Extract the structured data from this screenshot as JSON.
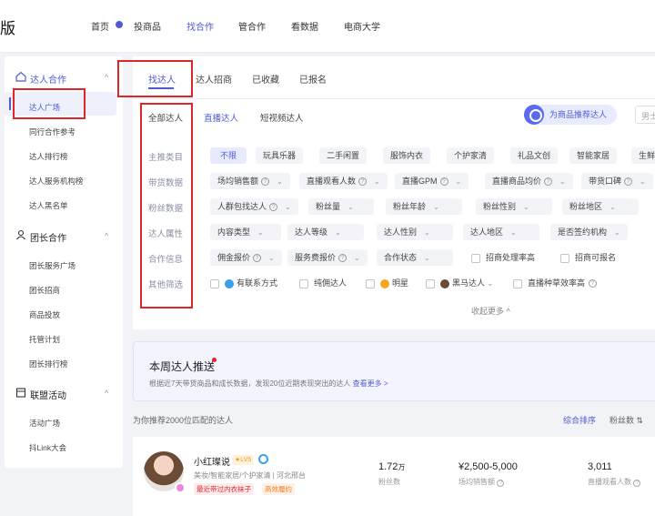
{
  "brand": "版",
  "topnav": {
    "items": [
      "首页",
      "投商品",
      "找合作",
      "管合作",
      "看数据",
      "电商大学"
    ],
    "active": "找合作"
  },
  "sidebar": {
    "sections": [
      {
        "title": "达人合作",
        "items": [
          "达人广场",
          "同行合作参考",
          "达人排行榜",
          "达人服务机构榜",
          "达人黑名单"
        ]
      },
      {
        "title": "团长合作",
        "items": [
          "团长服务广场",
          "团长招商",
          "商品投放",
          "托管计划",
          "团长排行榜"
        ]
      },
      {
        "title": "联盟活动",
        "items": [
          "活动广场",
          "抖Link大会"
        ]
      }
    ],
    "active_item": "达人广场"
  },
  "tabs": [
    "找达人",
    "达人招商",
    "已收藏",
    "已报名"
  ],
  "subtabs": [
    "全部达人",
    "直播达人",
    "短视频达人"
  ],
  "recommend_button": "为商品推荐达人",
  "sort_input_placeholder": "男士",
  "filters": {
    "labels": [
      "主推类目",
      "带货数据",
      "粉丝数据",
      "达人属性",
      "合作信息",
      "其他筛选"
    ],
    "category": [
      "不限",
      "玩具乐器",
      "二手闲置",
      "服饰内衣",
      "个护家清",
      "礼品文创",
      "智能家居",
      "生鲜"
    ],
    "sales": [
      "场均销售额",
      "直播观看人数",
      "直播GPM",
      "直播商品均价",
      "带货口碑"
    ],
    "fans": [
      "人群包找达人",
      "粉丝量",
      "粉丝年龄",
      "粉丝性别",
      "粉丝地区"
    ],
    "attributes": [
      "内容类型",
      "达人等级",
      "达人性别",
      "达人地区",
      "是否签约机构"
    ],
    "cooperation": [
      "佣金报价",
      "服务费报价",
      "合作状态",
      "招商处理率高",
      "招商可报名"
    ],
    "other": [
      "有联系方式",
      "纯佣达人",
      "明星",
      "黑马达人",
      "直播种草效率高"
    ]
  },
  "collapse_label": "收起更多 ^",
  "weekly": {
    "title": "本周达人推送",
    "desc": "根据近7天带货商品和成长数据，发现20位近期表现突出的达人",
    "link": "查看更多 >"
  },
  "match_text": "为你推荐2000位匹配的达人",
  "sort_options": [
    "综合排序",
    "粉丝数 ⇅"
  ],
  "influencer": {
    "name": "小红璨说",
    "level": "LV5",
    "tags": "美妆/智能家居/个护家清 | 河北邢台",
    "hot_tags": [
      "最近带过内衣袜子",
      "高效履约"
    ],
    "stats": [
      {
        "value": "1.72",
        "unit": "万",
        "label": "粉丝数"
      },
      {
        "value": "¥2,500-5,000",
        "unit": "",
        "label": "场均销售额"
      },
      {
        "value": "3,011",
        "unit": "",
        "label": "直播观看人数"
      }
    ]
  }
}
